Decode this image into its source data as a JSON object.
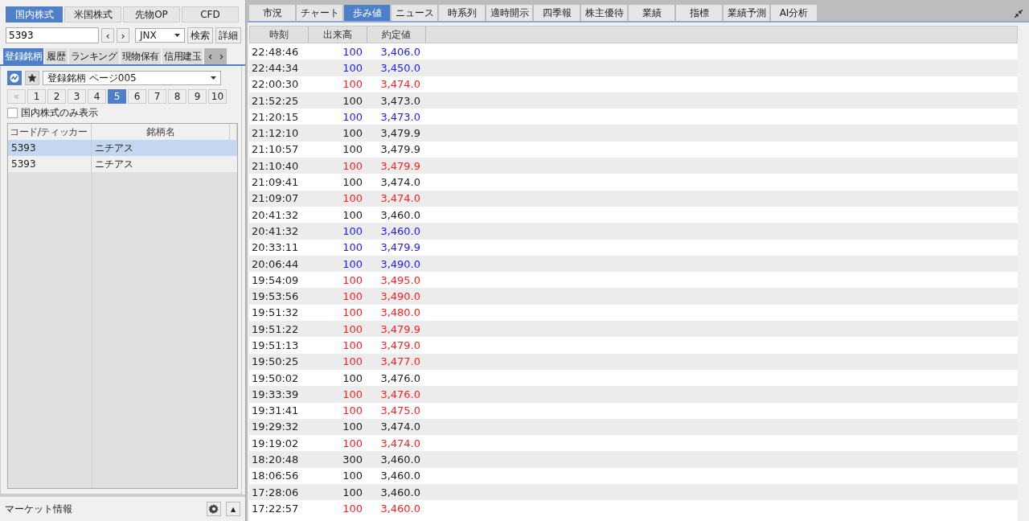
{
  "market_tabs": [
    {
      "label": "国内株式",
      "selected": true
    },
    {
      "label": "米国株式",
      "selected": false
    },
    {
      "label": "先物OP",
      "selected": false
    },
    {
      "label": "CFD",
      "selected": false
    }
  ],
  "search": {
    "code": "5393",
    "prev": "‹",
    "next": "›",
    "exchange": "JNX",
    "search_button": "検索",
    "detail_button": "詳細"
  },
  "list_tabs": [
    {
      "label": "登録銘柄",
      "selected": true
    },
    {
      "label": "履歴",
      "selected": false
    },
    {
      "label": "ランキング",
      "selected": false
    },
    {
      "label": "現物保有",
      "selected": false
    },
    {
      "label": "信用建玉",
      "selected": false
    }
  ],
  "list_tab_scroll": {
    "prev": "‹",
    "next": "›"
  },
  "watchlist": {
    "page_select": "登録銘柄 ページ005",
    "first_page": "«",
    "pages": [
      {
        "label": "1",
        "selected": false
      },
      {
        "label": "2",
        "selected": false
      },
      {
        "label": "3",
        "selected": false
      },
      {
        "label": "4",
        "selected": false
      },
      {
        "label": "5",
        "selected": true
      },
      {
        "label": "6",
        "selected": false
      },
      {
        "label": "7",
        "selected": false
      },
      {
        "label": "8",
        "selected": false
      },
      {
        "label": "9",
        "selected": false
      },
      {
        "label": "10",
        "selected": false
      }
    ],
    "domestic_only": {
      "label": "国内株式のみ表示",
      "checked": false
    },
    "columns": [
      "コード/ティッカー",
      "銘柄名"
    ],
    "rows": [
      {
        "code": "5393",
        "name": "ニチアス",
        "selected": true
      },
      {
        "code": "5393",
        "name": "ニチアス",
        "selected": false
      }
    ]
  },
  "market_info": {
    "label": "マーケット情報",
    "collapse": "▲"
  },
  "tabs": [
    {
      "label": "市況",
      "selected": false
    },
    {
      "label": "チャート",
      "selected": false
    },
    {
      "label": "歩み値",
      "selected": true
    },
    {
      "label": "ニュース",
      "selected": false
    },
    {
      "label": "時系列",
      "selected": false
    },
    {
      "label": "適時開示",
      "selected": false
    },
    {
      "label": "四季報",
      "selected": false
    },
    {
      "label": "株主優待",
      "selected": false
    },
    {
      "label": "業績",
      "selected": false
    },
    {
      "label": "指標",
      "selected": false
    },
    {
      "label": "業績予測",
      "selected": false
    },
    {
      "label": "AI分析",
      "selected": false
    }
  ],
  "trades": {
    "columns": [
      "時刻",
      "出来高",
      "約定値"
    ],
    "rows": [
      {
        "time": "22:48:46",
        "volume": "100",
        "price": "3,406.0",
        "color": "#1a1aff"
      },
      {
        "time": "22:44:34",
        "volume": "100",
        "price": "3,450.0",
        "color": "#1a1aff"
      },
      {
        "time": "22:00:30",
        "volume": "100",
        "price": "3,474.0",
        "color": "#ff2020"
      },
      {
        "time": "21:52:25",
        "volume": "100",
        "price": "3,473.0",
        "color": "#222222"
      },
      {
        "time": "21:20:15",
        "volume": "100",
        "price": "3,473.0",
        "color": "#1a1aff"
      },
      {
        "time": "21:12:10",
        "volume": "100",
        "price": "3,479.9",
        "color": "#222222"
      },
      {
        "time": "21:10:57",
        "volume": "100",
        "price": "3,479.9",
        "color": "#222222"
      },
      {
        "time": "21:10:40",
        "volume": "100",
        "price": "3,479.9",
        "color": "#ff2020"
      },
      {
        "time": "21:09:41",
        "volume": "100",
        "price": "3,474.0",
        "color": "#222222"
      },
      {
        "time": "21:09:07",
        "volume": "100",
        "price": "3,474.0",
        "color": "#ff2020"
      },
      {
        "time": "20:41:32",
        "volume": "100",
        "price": "3,460.0",
        "color": "#222222"
      },
      {
        "time": "20:41:32",
        "volume": "100",
        "price": "3,460.0",
        "color": "#1a1aff"
      },
      {
        "time": "20:33:11",
        "volume": "100",
        "price": "3,479.9",
        "color": "#1a1aff"
      },
      {
        "time": "20:06:44",
        "volume": "100",
        "price": "3,490.0",
        "color": "#1a1aff"
      },
      {
        "time": "19:54:09",
        "volume": "100",
        "price": "3,495.0",
        "color": "#ff2020"
      },
      {
        "time": "19:53:56",
        "volume": "100",
        "price": "3,490.0",
        "color": "#ff2020"
      },
      {
        "time": "19:51:32",
        "volume": "100",
        "price": "3,480.0",
        "color": "#ff2020"
      },
      {
        "time": "19:51:22",
        "volume": "100",
        "price": "3,479.9",
        "color": "#ff2020"
      },
      {
        "time": "19:51:13",
        "volume": "100",
        "price": "3,479.0",
        "color": "#ff2020"
      },
      {
        "time": "19:50:25",
        "volume": "100",
        "price": "3,477.0",
        "color": "#ff2020"
      },
      {
        "time": "19:50:02",
        "volume": "100",
        "price": "3,476.0",
        "color": "#222222"
      },
      {
        "time": "19:33:39",
        "volume": "100",
        "price": "3,476.0",
        "color": "#ff2020"
      },
      {
        "time": "19:31:41",
        "volume": "100",
        "price": "3,475.0",
        "color": "#ff2020"
      },
      {
        "time": "19:29:32",
        "volume": "100",
        "price": "3,474.0",
        "color": "#222222"
      },
      {
        "time": "19:19:02",
        "volume": "100",
        "price": "3,474.0",
        "color": "#ff2020"
      },
      {
        "time": "18:20:48",
        "volume": "300",
        "price": "3,460.0",
        "color": "#222222"
      },
      {
        "time": "18:06:56",
        "volume": "100",
        "price": "3,460.0",
        "color": "#222222"
      },
      {
        "time": "17:28:06",
        "volume": "100",
        "price": "3,460.0",
        "color": "#222222"
      },
      {
        "time": "17:22:57",
        "volume": "100",
        "price": "3,460.0",
        "color": "#ff2020"
      }
    ]
  }
}
